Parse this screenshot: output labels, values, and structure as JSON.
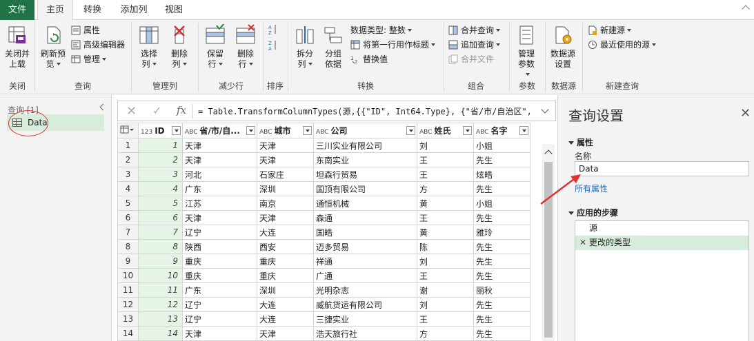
{
  "tabs": [
    "文件",
    "主页",
    "转换",
    "添加列",
    "视图"
  ],
  "ribbon": {
    "close_load": "关闭并上载",
    "close_group": "关闭",
    "refresh_preview": "刷新预览",
    "properties": "属性",
    "advanced_editor": "高级编辑器",
    "manage": "管理",
    "query_group": "查询",
    "choose_columns": "选择列",
    "remove_columns": "删除列",
    "manage_columns_group": "管理列",
    "keep_rows": "保留行",
    "remove_rows": "删除行",
    "reduce_rows_group": "减少行",
    "sort_group": "排序",
    "split_column": "拆分列",
    "group_by": "分组依据",
    "data_type": "数据类型: 整数",
    "first_row_header": "将第一行用作标题",
    "replace_values": "替换值",
    "transform_group": "转换",
    "merge_queries": "合并查询",
    "append_queries": "追加查询",
    "combine_files": "合并文件",
    "combine_group": "组合",
    "manage_params": "管理参数",
    "params_group": "参数",
    "data_source_settings": "数据源设置",
    "data_source_group": "数据源",
    "new_source": "新建源",
    "recent_sources": "最近使用的源",
    "new_query_group": "新建查询"
  },
  "left_pane": {
    "header": "查询 [1]",
    "query_name": "Data"
  },
  "formula": "= Table.TransformColumnTypes(源,{{\"ID\", Int64.Type}, {\"省/市/自治区\",",
  "table": {
    "columns": [
      {
        "type": "123",
        "name": "ID"
      },
      {
        "type": "ABC",
        "name": "省/市/自..."
      },
      {
        "type": "ABC",
        "name": "城市"
      },
      {
        "type": "ABC",
        "name": "公司"
      },
      {
        "type": "ABC",
        "name": "姓氏"
      },
      {
        "type": "ABC",
        "name": "名字"
      }
    ],
    "rows": [
      [
        "1",
        "1",
        "天津",
        "天津",
        "三川实业有限公司",
        "刘",
        "小姐"
      ],
      [
        "2",
        "2",
        "天津",
        "天津",
        "东南实业",
        "王",
        "先生"
      ],
      [
        "3",
        "3",
        "河北",
        "石家庄",
        "坦森行贸易",
        "王",
        "炫皓"
      ],
      [
        "4",
        "4",
        "广东",
        "深圳",
        "国顶有限公司",
        "方",
        "先生"
      ],
      [
        "5",
        "5",
        "江苏",
        "南京",
        "通恒机械",
        "黄",
        "小姐"
      ],
      [
        "6",
        "6",
        "天津",
        "天津",
        "森通",
        "王",
        "先生"
      ],
      [
        "7",
        "7",
        "辽宁",
        "大连",
        "国皓",
        "黄",
        "雅玲"
      ],
      [
        "8",
        "8",
        "陕西",
        "西安",
        "迈多贸易",
        "陈",
        "先生"
      ],
      [
        "9",
        "9",
        "重庆",
        "重庆",
        "祥通",
        "刘",
        "先生"
      ],
      [
        "10",
        "10",
        "重庆",
        "重庆",
        "广通",
        "王",
        "先生"
      ],
      [
        "11",
        "11",
        "广东",
        "深圳",
        "光明杂志",
        "谢",
        "丽秋"
      ],
      [
        "12",
        "12",
        "辽宁",
        "大连",
        "威航货运有限公司",
        "刘",
        "先生"
      ],
      [
        "13",
        "13",
        "辽宁",
        "大连",
        "三捷实业",
        "王",
        "先生"
      ],
      [
        "14",
        "14",
        "天津",
        "天津",
        "浩天旅行社",
        "方",
        "先生"
      ]
    ]
  },
  "right_pane": {
    "title": "查询设置",
    "properties_header": "属性",
    "name_label": "名称",
    "name_value": "Data",
    "all_properties": "所有属性",
    "steps_header": "应用的步骤",
    "steps": [
      "源",
      "更改的类型"
    ]
  },
  "colors": {
    "accent": "#217346",
    "selected_bg": "#d8ecdc",
    "annotation": "#e03030"
  }
}
